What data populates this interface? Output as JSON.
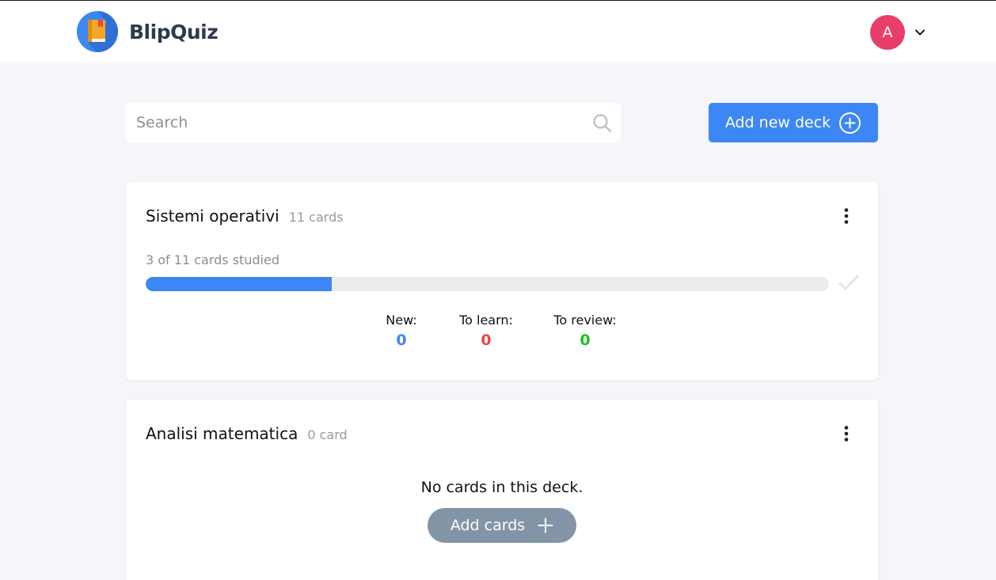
{
  "app": {
    "name": "BlipQuiz"
  },
  "user": {
    "avatar_letter": "A"
  },
  "search": {
    "placeholder": "Search",
    "value": ""
  },
  "actions": {
    "add_deck_label": "Add new deck"
  },
  "colors": {
    "accent": "#3d86f6",
    "avatar": "#ea3e6a",
    "new": "#3d86f6",
    "to_learn": "#e94848",
    "to_review": "#20c020",
    "add_cards": "#8295a7"
  },
  "decks": [
    {
      "title": "Sistemi operativi",
      "count_label": "11 cards",
      "progress_label": "3 of 11 cards studied",
      "progress_fraction": 0.2727,
      "stats": [
        {
          "label": "New:",
          "value": "0"
        },
        {
          "label": "To learn:",
          "value": "0"
        },
        {
          "label": "To review:",
          "value": "0"
        }
      ]
    },
    {
      "title": "Analisi matematica",
      "count_label": "0 card",
      "empty_message": "No cards in this deck.",
      "add_cards_label": "Add cards"
    }
  ],
  "icons": [
    "book-logo-icon",
    "chevron-down-icon",
    "search-icon",
    "plus-circle-icon",
    "more-vertical-icon",
    "check-icon",
    "plus-icon"
  ]
}
